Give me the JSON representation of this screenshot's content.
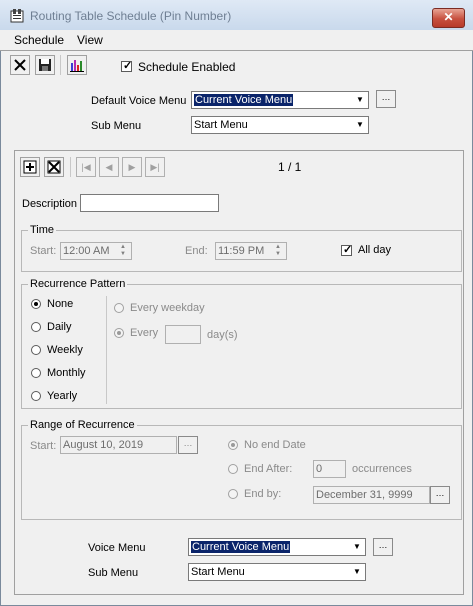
{
  "window": {
    "title": "Routing Table Schedule (Pin Number)",
    "close_label": "✕"
  },
  "menu": {
    "items": [
      "Schedule",
      "View"
    ]
  },
  "toolbar": {
    "delete_icon": "close-x-icon",
    "save_icon": "floppy-disk-icon",
    "chart_icon": "bar-chart-icon"
  },
  "schedule_enabled": {
    "label": "Schedule Enabled",
    "checked": true
  },
  "defaults": {
    "voice_menu_label": "Default Voice Menu",
    "voice_menu_value": "Current Voice Menu",
    "sub_menu_label": "Sub Menu",
    "sub_menu_value": "Start Menu"
  },
  "nav": {
    "page": "1 / 1"
  },
  "description": {
    "label": "Description",
    "value": ""
  },
  "time": {
    "title": "Time",
    "start_label": "Start:",
    "start_value": "12:00 AM",
    "end_label": "End:",
    "end_value": "11:59 PM",
    "all_day_label": "All day",
    "all_day_checked": true
  },
  "recurrence": {
    "title": "Recurrence Pattern",
    "options": [
      "None",
      "Daily",
      "Weekly",
      "Monthly",
      "Yearly"
    ],
    "selected": "None",
    "every_weekday_label": "Every weekday",
    "every_label": "Every",
    "every_value": "",
    "days_label": "day(s)"
  },
  "range": {
    "title": "Range of Recurrence",
    "start_label": "Start:",
    "start_value": "August 10, 2019",
    "no_end_label": "No end Date",
    "end_after_label": "End After:",
    "end_after_value": "0",
    "occurrences_label": "occurrences",
    "end_by_label": "End by:",
    "end_by_value": "December 31, 9999"
  },
  "bottom": {
    "voice_menu_label": "Voice Menu",
    "voice_menu_value": "Current Voice Menu",
    "sub_menu_label": "Sub Menu",
    "sub_menu_value": "Start Menu"
  }
}
